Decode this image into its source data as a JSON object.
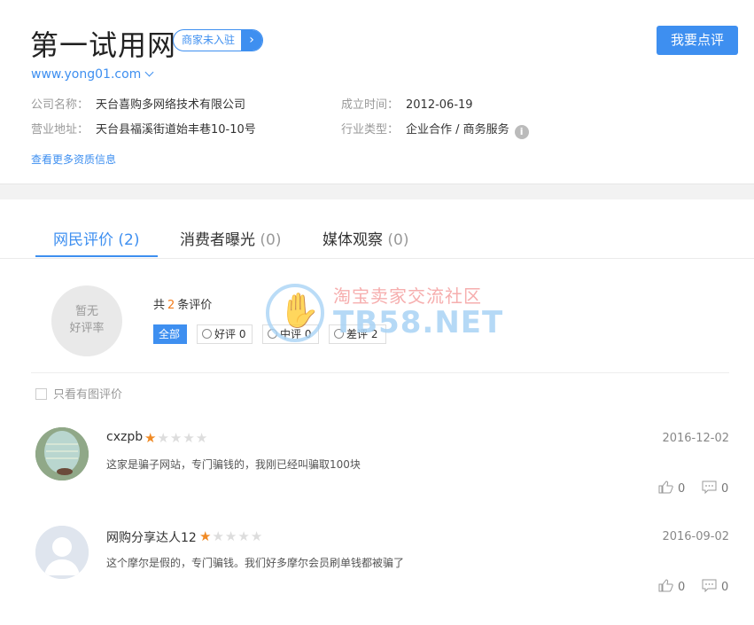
{
  "company": {
    "title": "第一试用网",
    "merchant_badge": "商家未入驻",
    "review_button": "我要点评",
    "site_url": "www.yong01.com",
    "name_label": "公司名称：",
    "name_value": "天台喜购多网络技术有限公司",
    "founded_label": "成立时间：",
    "founded_value": "2012-06-19",
    "address_label": "营业地址：",
    "address_value": "天台县福溪街道始丰巷10-10号",
    "industry_label": "行业类型：",
    "industry_value": "企业合作 / 商务服务",
    "info_icon": "i",
    "more_link": "查看更多资质信息"
  },
  "tabs": [
    {
      "label": "网民评价",
      "count": "(2)",
      "active": true
    },
    {
      "label": "消费者曝光",
      "count": "(0)",
      "active": false
    },
    {
      "label": "媒体观察",
      "count": "(0)",
      "active": false
    }
  ],
  "summary": {
    "rate_line1": "暂无",
    "rate_line2": "好评率",
    "total_prefix": "共",
    "total_count": "2",
    "total_suffix": "条评价",
    "filters": {
      "all": "全部",
      "good": "好评 0",
      "neutral": "中评 0",
      "bad": "差评 2"
    },
    "pic_only": "只看有图评价"
  },
  "watermark": {
    "cn": "淘宝卖家交流社区",
    "en": "TB58.NET"
  },
  "reviews": [
    {
      "user": "cxzpb",
      "rating": 1,
      "max_rating": 5,
      "date": "2016-12-02",
      "text": "这家是骗子网站，专门骗钱的，我刚已经叫骗取100块",
      "likes": "0",
      "comments": "0"
    },
    {
      "user": "网购分享达人12",
      "rating": 1,
      "max_rating": 5,
      "date": "2016-09-02",
      "text": "这个摩尔是假的，专门骗钱。我们好多摩尔会员刷单钱都被骗了",
      "likes": "0",
      "comments": "0"
    }
  ],
  "colors": {
    "accent": "#3e8ff0",
    "star": "#f08a24",
    "count_highlight": "#f27a18"
  }
}
